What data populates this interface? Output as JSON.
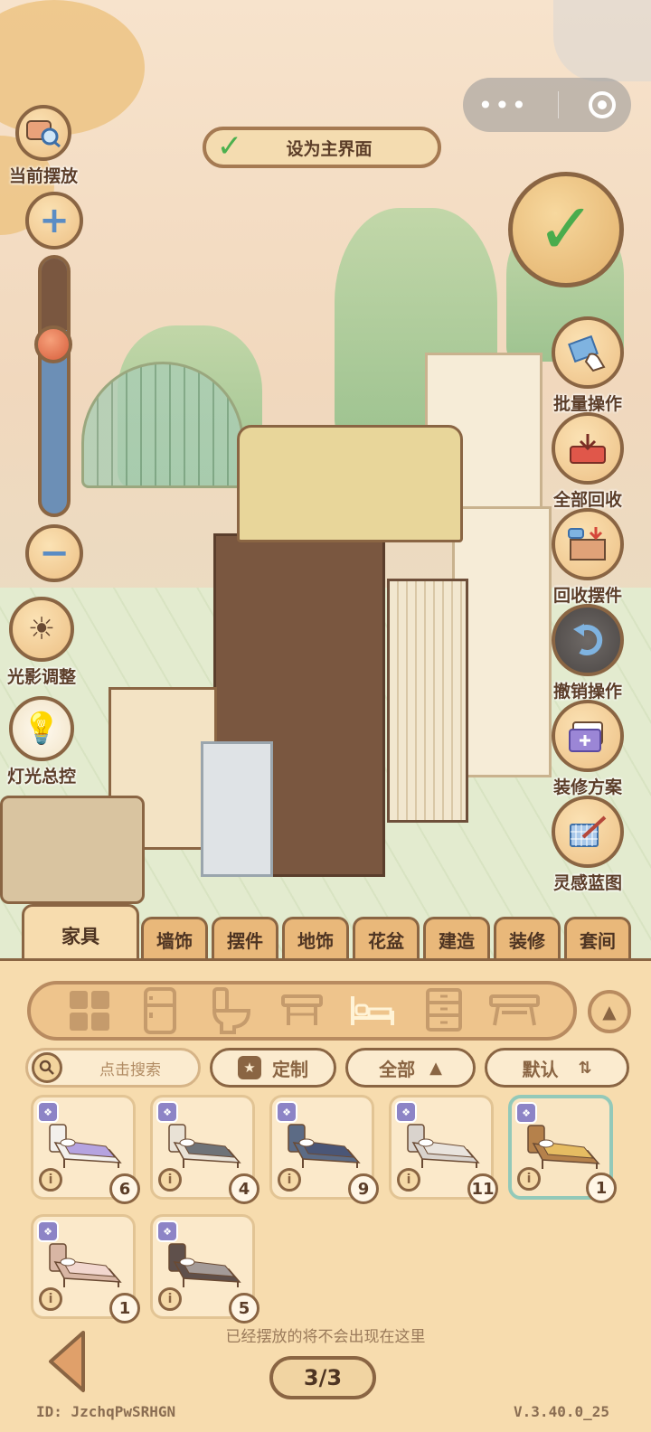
{
  "capsule": {
    "more_icon": "more-dots-icon",
    "close_icon": "target-icon"
  },
  "set_main": {
    "label": "设为主界面"
  },
  "left_tools": {
    "current": "当前摆放",
    "light_adjust": "光影调整",
    "light_control": "灯光总控"
  },
  "right_tools": [
    {
      "label": "批量操作",
      "icon": "batch-hand-icon"
    },
    {
      "label": "全部回收",
      "icon": "recycle-all-icon"
    },
    {
      "label": "回收摆件",
      "icon": "recycle-box-icon"
    },
    {
      "label": "撤销操作",
      "icon": "undo-icon"
    },
    {
      "label": "装修方案",
      "icon": "plan-folder-icon"
    },
    {
      "label": "灵感蓝图",
      "icon": "blueprint-icon"
    }
  ],
  "tabs": [
    "家具",
    "墙饰",
    "摆件",
    "地饰",
    "花盆",
    "建造",
    "装修",
    "套间"
  ],
  "categories": [
    "all-grid-icon",
    "fridge-icon",
    "toilet-icon",
    "table-icon",
    "bed-icon",
    "cabinet-icon",
    "desk-icon"
  ],
  "search": {
    "placeholder": "点击搜索"
  },
  "filters": {
    "custom": "定制",
    "all": "全部",
    "sort": "默认"
  },
  "items": [
    {
      "count": "6",
      "sheet": "#b5a3e0",
      "frame": "#f3f0ec",
      "selected": false
    },
    {
      "count": "4",
      "sheet": "#6f7378",
      "frame": "#e9e2d6",
      "selected": false
    },
    {
      "count": "9",
      "sheet": "#4a5677",
      "frame": "#5c6b85",
      "selected": false
    },
    {
      "count": "11",
      "sheet": "#e9e4de",
      "frame": "#d9d3cd",
      "selected": false
    },
    {
      "count": "1",
      "sheet": "#e6bc62",
      "frame": "#b5814b",
      "selected": true
    },
    {
      "count": "1",
      "sheet": "#f2d7cf",
      "frame": "#d8b6a4",
      "selected": false
    },
    {
      "count": "5",
      "sheet": "#a49b98",
      "frame": "#5f504b",
      "selected": false
    }
  ],
  "hint": "已经摆放的将不会出现在这里",
  "pager": "3/3",
  "footer": {
    "id": "ID: JzchqPwSRHGN",
    "version": "V.3.40.0_25"
  }
}
